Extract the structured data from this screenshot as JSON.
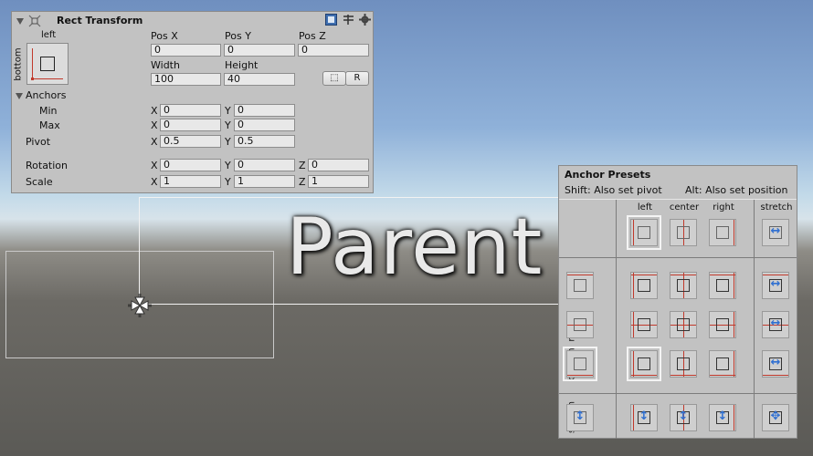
{
  "scene": {
    "parent_label": "Parent"
  },
  "inspector": {
    "title": "Rect Transform",
    "icons": [
      "rect-transform-icon",
      "book-icon",
      "settings-sliders-icon",
      "gear-icon"
    ],
    "anchor_widget": {
      "top_label": "left",
      "side_label": "bottom"
    },
    "pos": {
      "x_label": "Pos X",
      "y_label": "Pos Y",
      "z_label": "Pos Z",
      "x": "0",
      "y": "0",
      "z": "0"
    },
    "size": {
      "w_label": "Width",
      "h_label": "Height",
      "w": "100",
      "h": "40"
    },
    "buttons": {
      "blueprint": "⬚",
      "raw": "R"
    },
    "anchors": {
      "label": "Anchors",
      "min_label": "Min",
      "min_x": "0",
      "min_y": "0",
      "max_label": "Max",
      "max_x": "0",
      "max_y": "0"
    },
    "pivot": {
      "label": "Pivot",
      "x": "0.5",
      "y": "0.5"
    },
    "rotation": {
      "label": "Rotation",
      "x": "0",
      "y": "0",
      "z": "0"
    },
    "scale": {
      "label": "Scale",
      "x": "1",
      "y": "1",
      "z": "1"
    },
    "axis": {
      "x": "X",
      "y": "Y",
      "z": "Z"
    }
  },
  "presets": {
    "title": "Anchor Presets",
    "shift_hint": "Shift: Also set pivot",
    "alt_hint": "Alt: Also set position",
    "columns": [
      "left",
      "center",
      "right",
      "stretch"
    ],
    "rows": [
      "top",
      "middle",
      "bottom",
      "stretch"
    ],
    "selected": {
      "row": "bottom",
      "column": "left"
    },
    "colors": {
      "anchor": "#c0392b",
      "stretch": "#2f6fd1"
    }
  }
}
